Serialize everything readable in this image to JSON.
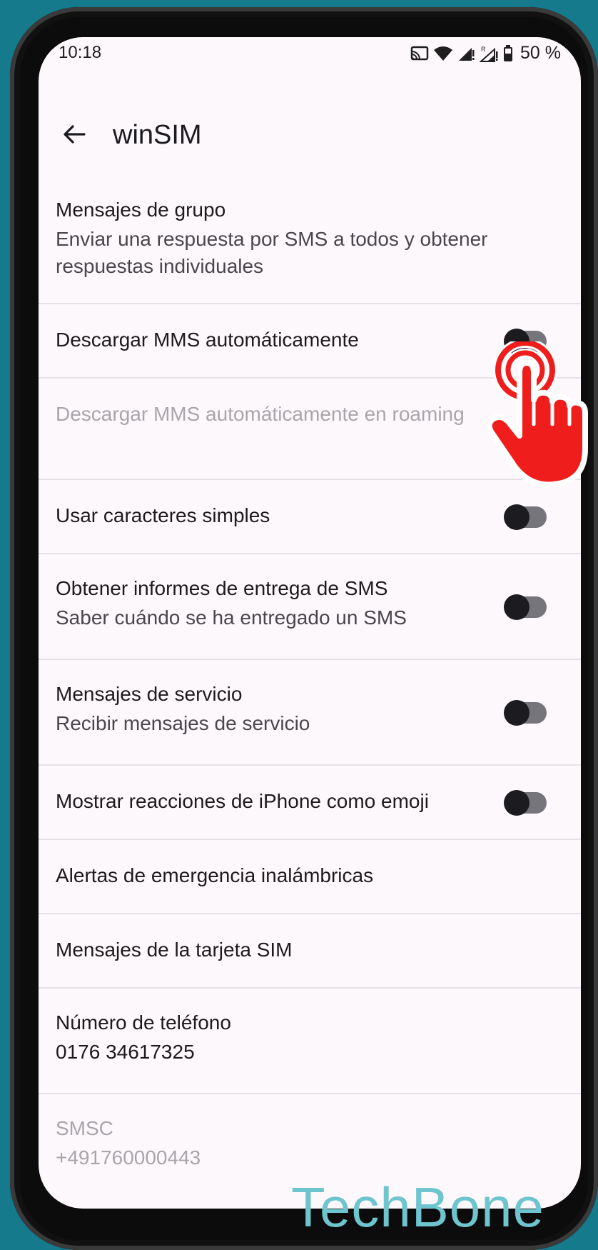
{
  "status_bar": {
    "time": "10:18",
    "battery": "50 %",
    "icons": [
      "cast-icon",
      "wifi-icon",
      "signal-icon",
      "signal-roaming-icon",
      "battery-icon"
    ]
  },
  "app_bar": {
    "title": "winSIM",
    "back_icon": "arrow-left-icon"
  },
  "settings": [
    {
      "id": "group",
      "title": "Mensajes de grupo",
      "subtitle": "Enviar una respuesta por SMS a todos y obtener respuestas individuales",
      "toggle": null,
      "enabled": true
    },
    {
      "id": "mms-auto",
      "title": "Descargar MMS automáticamente",
      "subtitle": "",
      "toggle": false,
      "enabled": true
    },
    {
      "id": "mms-roaming",
      "title": "Descargar MMS automáticamente en roaming",
      "subtitle": "",
      "toggle": false,
      "enabled": false
    },
    {
      "id": "simple-chars",
      "title": "Usar caracteres simples",
      "subtitle": "",
      "toggle": false,
      "enabled": true
    },
    {
      "id": "delivery-reports",
      "title": "Obtener informes de entrega de SMS",
      "subtitle": "Saber cuándo se ha entregado un SMS",
      "toggle": false,
      "enabled": true
    },
    {
      "id": "service-messages",
      "title": "Mensajes de servicio",
      "subtitle": "Recibir mensajes de servicio",
      "toggle": false,
      "enabled": true
    },
    {
      "id": "iphone-reactions",
      "title": "Mostrar reacciones de iPhone como emoji",
      "subtitle": "",
      "toggle": false,
      "enabled": true
    },
    {
      "id": "emergency-alerts",
      "title": "Alertas de emergencia inalámbricas",
      "subtitle": "",
      "toggle": null,
      "enabled": true
    },
    {
      "id": "sim-messages",
      "title": "Mensajes de la tarjeta SIM",
      "subtitle": "",
      "toggle": null,
      "enabled": true
    },
    {
      "id": "phone-number",
      "title": "Número de teléfono",
      "subtitle": "0176 34617325",
      "toggle": null,
      "enabled": true
    },
    {
      "id": "smsc",
      "title": "SMSC",
      "subtitle": "+491760000443",
      "toggle": null,
      "enabled": false
    }
  ],
  "watermark": "TechBone",
  "colors": {
    "background": "#157a8c",
    "screen": "#fdf8fc",
    "pointer_hand": "#f01d1d",
    "watermark": "#6ec5cf"
  }
}
